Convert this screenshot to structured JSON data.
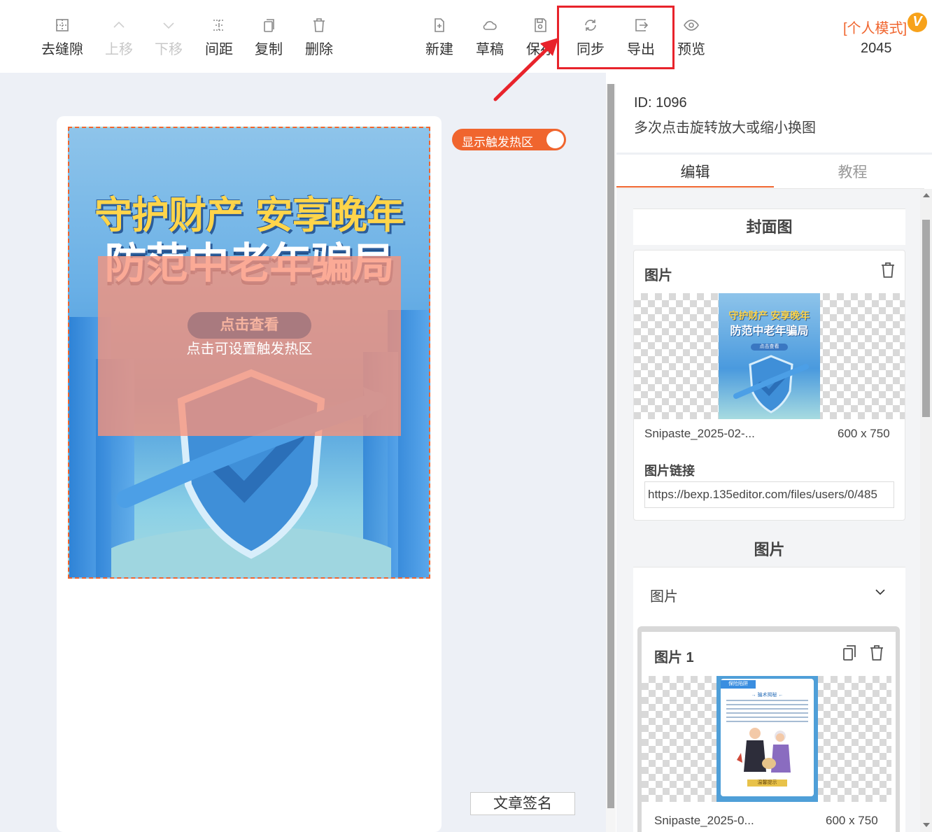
{
  "toolbar": {
    "left_buttons": [
      {
        "label": "去缝隙",
        "icon": "grid-icon",
        "disabled": false
      },
      {
        "label": "上移",
        "icon": "chevron-up-icon",
        "disabled": true
      },
      {
        "label": "下移",
        "icon": "chevron-down-icon",
        "disabled": true
      },
      {
        "label": "间距",
        "icon": "spacing-icon",
        "disabled": false
      },
      {
        "label": "复制",
        "icon": "copy-icon",
        "disabled": false
      },
      {
        "label": "删除",
        "icon": "trash-icon",
        "disabled": false
      }
    ],
    "right_buttons": [
      {
        "label": "新建",
        "icon": "new-file-icon"
      },
      {
        "label": "草稿",
        "icon": "cloud-icon"
      },
      {
        "label": "保存",
        "icon": "save-icon"
      },
      {
        "label": "同步",
        "icon": "sync-icon"
      },
      {
        "label": "导出",
        "icon": "export-icon"
      },
      {
        "label": "预览",
        "icon": "eye-icon"
      }
    ],
    "mode_label": "[个人模式]",
    "vip_badge": "V",
    "count": "2045"
  },
  "canvas": {
    "poster_title_1": "守护财产 安享晚年",
    "poster_title_2": "防范中老年骗局",
    "poster_button": "点击查看",
    "hotzone_text": "点击可设置触发热区",
    "toggle_label": "显示触发热区",
    "toggle_on": true,
    "sign_button": "文章签名"
  },
  "panel": {
    "id_text": "ID: 1096",
    "description": "多次点击旋转放大或缩小换图",
    "tabs": [
      {
        "label": "编辑",
        "active": true
      },
      {
        "label": "教程",
        "active": false
      }
    ],
    "cover_section": {
      "heading": "封面图",
      "card_title": "图片",
      "thumb_title_1": "守护财产 安享晚年",
      "thumb_title_2": "防范中老年骗局",
      "thumb_button": "点击查看",
      "file_name": "Snipaste_2025-02-...",
      "file_size": "600 x 750",
      "link_label": "图片链接",
      "link_value": "https://bexp.135editor.com/files/users/0/485"
    },
    "image_section": {
      "heading": "图片",
      "dropdown_label": "图片",
      "item_title": "图片 1",
      "thumb_tag": "保险陷阱",
      "thumb_subtitle": "→ 骗术揭秘 ←",
      "thumb_footer": "温馨提示",
      "file_name": "Snipaste_2025-0...",
      "file_size": "600 x 750"
    }
  },
  "colors": {
    "accent": "#f0652e",
    "highlight_red": "#e8232b",
    "canvas_bg": "#edf0f6"
  }
}
